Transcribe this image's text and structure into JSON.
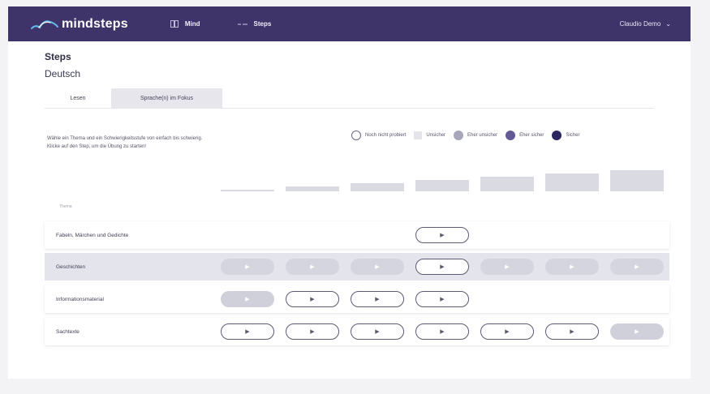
{
  "header": {
    "logo_text": "mindsteps",
    "nav": [
      {
        "label": "Mind",
        "icon": "book-icon"
      },
      {
        "label": "Steps",
        "icon": "steps-icon"
      }
    ],
    "user": "Claudio Demo"
  },
  "page": {
    "title": "Steps",
    "subject": "Deutsch",
    "tabs": [
      "Lesen",
      "Sprache(n) im Fokus"
    ],
    "active_tab": "Lesen",
    "instruction_line1": "Wähle ein Thema und ein Schwierigkeitsstufe von einfach bis schwierig.",
    "instruction_line2": "Klicke auf den Step, um die Übung zu starten!",
    "legend": [
      {
        "label": "Noch nicht probiert",
        "style": "open"
      },
      {
        "label": "Unsicher",
        "style": "square"
      },
      {
        "label": "Eher unsicher",
        "style": "light"
      },
      {
        "label": "Eher sicher",
        "style": "mid"
      },
      {
        "label": "Sicher",
        "style": "dark"
      }
    ],
    "column_header": "Thema",
    "difficulty_levels": 7,
    "rows": [
      {
        "label": "Fabeln, Märchen und Gedichte",
        "cells": [
          "none",
          "none",
          "none",
          "open",
          "none",
          "none",
          "none"
        ],
        "highlight": false
      },
      {
        "label": "Geschichten",
        "cells": [
          "filled",
          "filled",
          "filled",
          "open",
          "filled",
          "filled",
          "filled"
        ],
        "highlight": true
      },
      {
        "label": "Informationsmaterial",
        "cells": [
          "filled",
          "open",
          "open",
          "open",
          "none",
          "none",
          "none"
        ],
        "highlight": false
      },
      {
        "label": "Sachtexte",
        "cells": [
          "open",
          "open",
          "open",
          "open",
          "open",
          "open",
          "filled"
        ],
        "highlight": false
      }
    ],
    "play_glyph": "▶",
    "filled_glyph": "▶"
  },
  "colors": {
    "header_bg": "#3f3469",
    "accent": "#2d2760",
    "row_highlight": "#e4e4ec"
  }
}
